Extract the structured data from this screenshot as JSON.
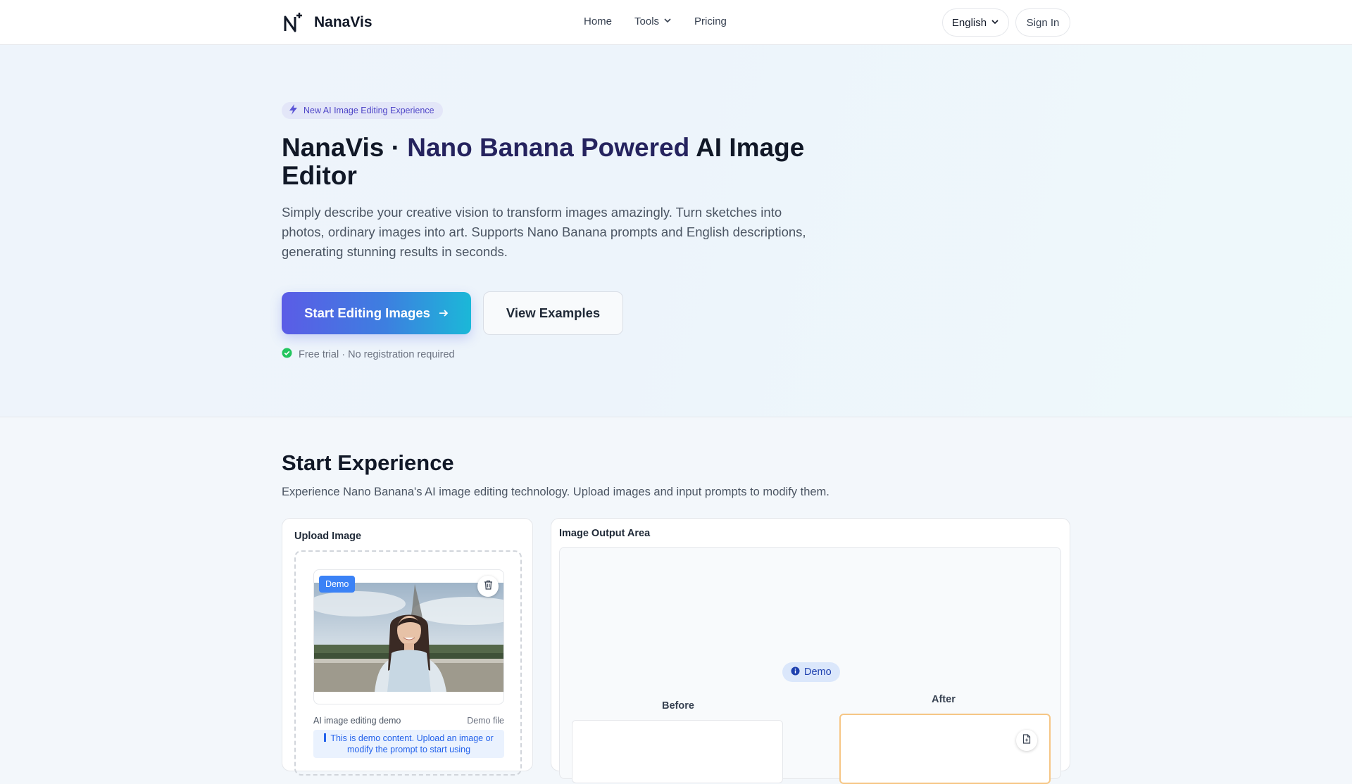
{
  "nav": {
    "brand": "NanaVis",
    "links": {
      "home": "Home",
      "tools": "Tools",
      "pricing": "Pricing"
    },
    "language": "English",
    "sign_in": "Sign In"
  },
  "hero": {
    "badge": "New AI Image Editing Experience",
    "title_part1": "NanaVis · ",
    "title_accent": "Nano Banana Powered",
    "title_part2": " AI Image Editor",
    "description": "Simply describe your creative vision to transform images amazingly. Turn sketches into photos, ordinary images into art. Supports Nano Banana prompts and English descriptions, generating stunning results in seconds.",
    "primary_button": "Start Editing Images",
    "secondary_button": "View Examples",
    "trial_note": "Free trial · No registration required"
  },
  "experience": {
    "title": "Start Experience",
    "description": "Experience Nano Banana's AI image editing technology. Upload images and input prompts to modify them.",
    "upload": {
      "label": "Upload Image",
      "demo_tag": "Demo",
      "file_name": "AI image editing demo",
      "file_meta": "Demo file",
      "info": "This is demo content. Upload an image or modify the prompt to start using"
    },
    "output": {
      "label": "Image Output Area",
      "demo_pill": "Demo",
      "before_label": "Before",
      "after_label": "After"
    }
  },
  "colors": {
    "accent": "#25235e",
    "primary_gradient_start": "#5b5ce6",
    "primary_gradient_end": "#1bb8d8",
    "demo_blue": "#3b82f6",
    "success_green": "#22c55e",
    "after_border": "#f6c685"
  },
  "icons": {
    "logo": "n-plus-logo-icon",
    "tools_chevron": "chevron-down-icon",
    "language_chevron": "chevron-down-icon",
    "badge": "lightning-icon",
    "primary_arrow": "arrow-right-icon",
    "trial": "check-circle-icon",
    "trash": "trash-icon",
    "info": "info-icon",
    "doc": "document-icon"
  }
}
